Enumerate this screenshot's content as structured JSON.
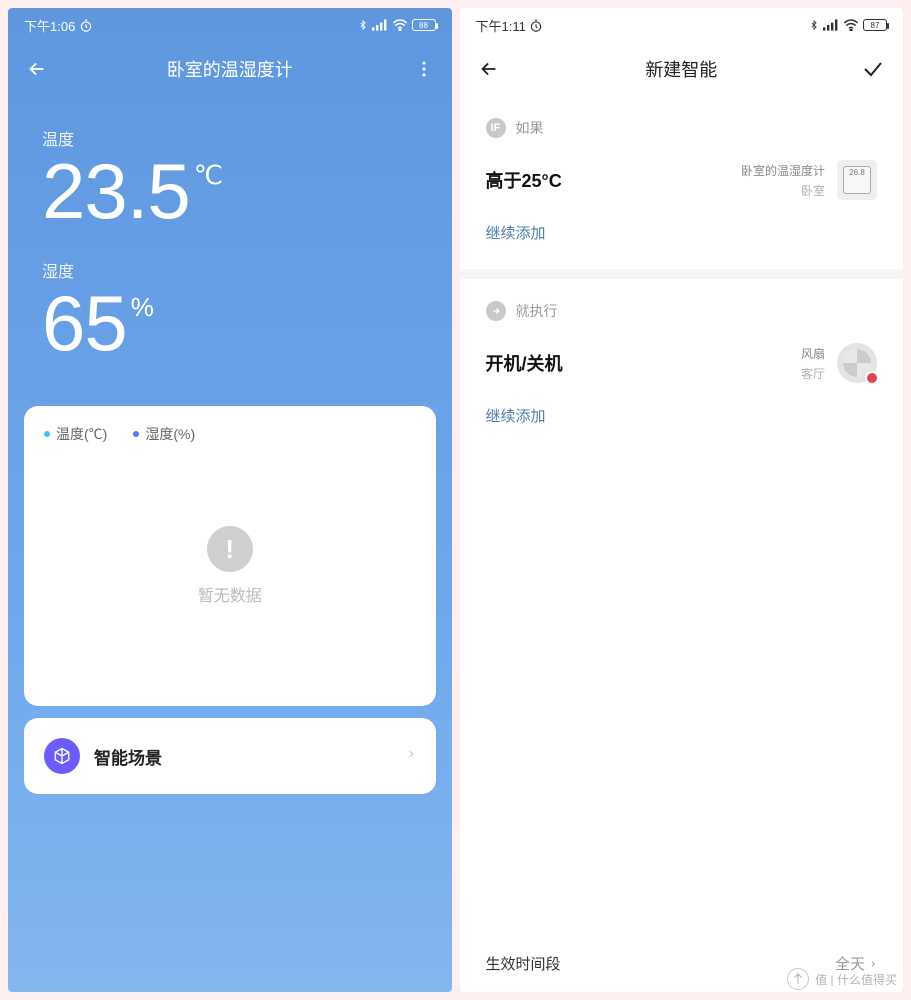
{
  "left": {
    "status": {
      "time": "下午1:06",
      "battery": "88"
    },
    "nav": {
      "title": "卧室的温湿度计"
    },
    "temp": {
      "label": "温度",
      "value": "23.5",
      "unit": "℃"
    },
    "hum": {
      "label": "湿度",
      "value": "65",
      "unit": "%"
    },
    "legend": {
      "temp": "温度(℃)",
      "hum": "湿度(%)"
    },
    "empty_text": "暂无数据",
    "scene_label": "智能场景"
  },
  "right": {
    "status": {
      "time": "下午1:11",
      "battery": "87"
    },
    "nav": {
      "title": "新建智能"
    },
    "if_label": "如果",
    "condition": {
      "text": "高于25°C",
      "device_name": "卧室的温湿度计",
      "device_room": "卧室",
      "display_reading": "26.8"
    },
    "continue_add": "继续添加",
    "then_label": "就执行",
    "action": {
      "text": "开机/关机",
      "device_name": "风扇",
      "device_room": "客厅"
    },
    "footer": {
      "label": "生效时间段",
      "value": "全天"
    }
  },
  "watermark": "值 | 什么值得买"
}
